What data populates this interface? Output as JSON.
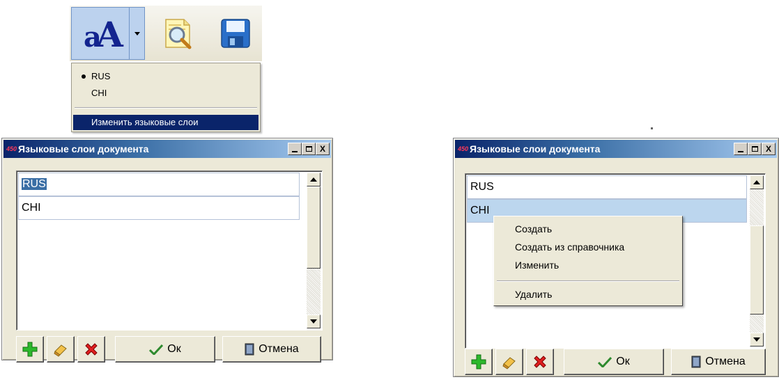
{
  "toolbar": {
    "font_button_icon": "font-language-icon",
    "dropdown_icon": "chevron-down-icon",
    "search_icon": "magnifier-document-icon",
    "save_icon": "floppy-disk-icon"
  },
  "language_menu": {
    "items": [
      {
        "label": "RUS",
        "checked": true
      },
      {
        "label": "CHI",
        "checked": false
      }
    ],
    "action": "Изменить языковые слои"
  },
  "window_left": {
    "app_logo": "450",
    "title": "Языковые слои документа",
    "controls": {
      "minimize": "_",
      "maximize": "□",
      "close": "X"
    },
    "rows": [
      "RUS",
      "CHI"
    ],
    "selected_row": "RUS",
    "buttons": {
      "ok": "Ок",
      "cancel": "Отмена"
    }
  },
  "window_right": {
    "app_logo": "450",
    "title": "Языковые слои документа",
    "controls": {
      "minimize": "_",
      "maximize": "□",
      "close": "X"
    },
    "rows": [
      "RUS",
      "CHI"
    ],
    "selected_row": "CHI",
    "buttons": {
      "ok": "Ок",
      "cancel": "Отмена"
    }
  },
  "context_menu": {
    "items": [
      "Создать",
      "Создать из справочника",
      "Изменить"
    ],
    "delete": "Удалить"
  },
  "colors": {
    "title_start": "#0a246a",
    "title_end": "#a6caf0",
    "selection": "#0a246a",
    "row_highlight": "#bcd6ee",
    "add_icon": "#2cb82c",
    "delete_icon": "#e02020"
  }
}
